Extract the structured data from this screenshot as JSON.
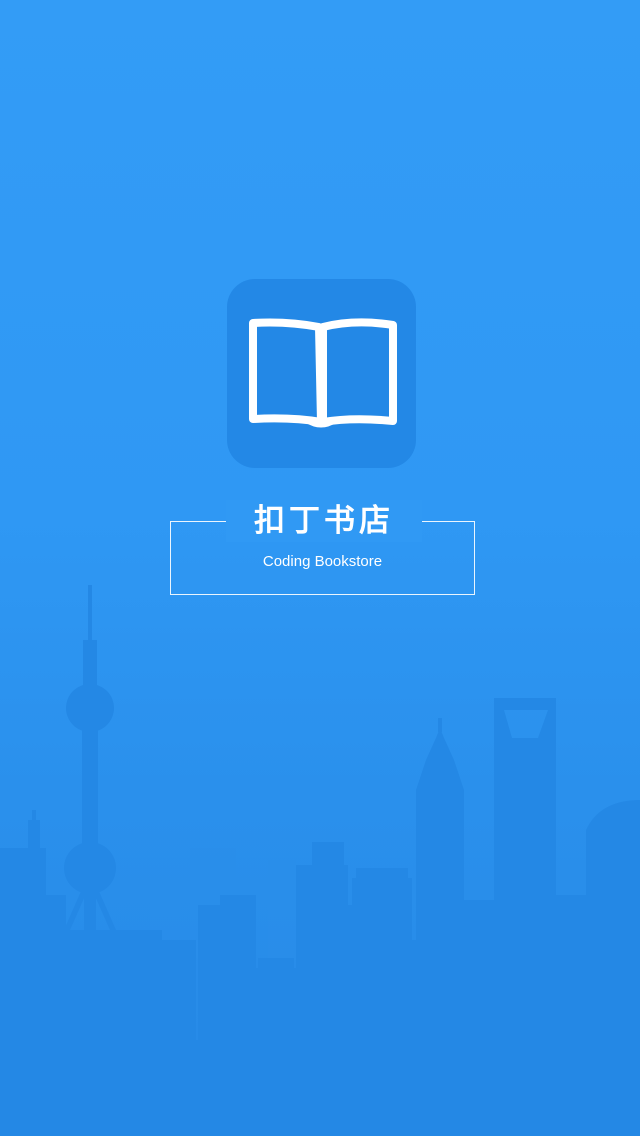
{
  "splash": {
    "title": "扣丁书店",
    "subtitle": "Coding Bookstore"
  },
  "icons": {
    "app_icon": "open-book-icon"
  },
  "colors": {
    "background_top": "#339cf6",
    "background_bottom": "#2689e6",
    "icon_tile": "#2388e6",
    "skyline": "#2488e5",
    "text": "#ffffff"
  }
}
